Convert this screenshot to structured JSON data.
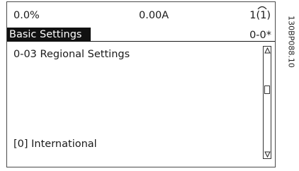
{
  "status": {
    "left": "0.0%",
    "middle": "0.00A",
    "setup": "1(1)"
  },
  "menu": {
    "title": "Basic Settings",
    "code": "0-0*"
  },
  "parameter": {
    "title": "0-03 Regional Settings",
    "value": "[0] International"
  },
  "scrollbar": {
    "position": 0.35
  },
  "drawing_id": "130BP088.10"
}
